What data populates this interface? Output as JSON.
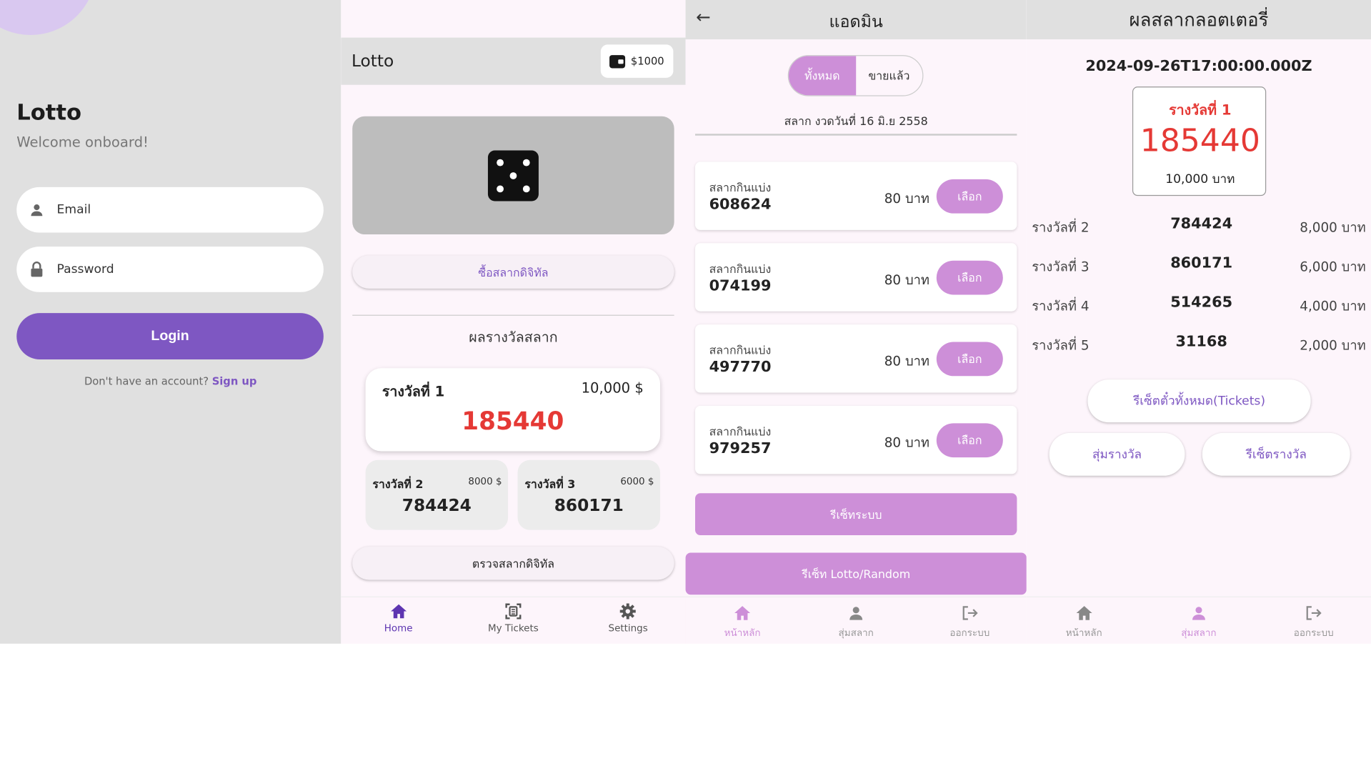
{
  "login": {
    "title": "Lotto",
    "subtitle": "Welcome onboard!",
    "email_placeholder": "Email",
    "password_placeholder": "Password",
    "login_label": "Login",
    "signup_prompt": "Don't have an account?",
    "signup_link": "Sign up",
    "accent": "#7e57c2"
  },
  "home": {
    "app_title": "Lotto",
    "wallet_balance": "$1000",
    "buy_button": "ซื้อสลากดิจิทัล",
    "results_title": "ผลรางวัลสลาก",
    "prize1": {
      "label": "รางวัลที่ 1",
      "amount": "10,000 $",
      "number": "185440"
    },
    "prize2": {
      "label": "รางวัลที่ 2",
      "amount": "8000 $",
      "number": "784424"
    },
    "prize3": {
      "label": "รางวัลที่ 3",
      "amount": "6000 $",
      "number": "860171"
    },
    "check_button": "ตรวจสลากดิจิทัล",
    "nav": [
      {
        "label": "Home",
        "icon": "home-icon",
        "active": true
      },
      {
        "label": "My Tickets",
        "icon": "ticket-icon",
        "active": false
      },
      {
        "label": "Settings",
        "icon": "gear-icon",
        "active": false
      }
    ]
  },
  "admin": {
    "title": "แอดมิน",
    "segments": [
      "ทั้งหมด",
      "ขายแล้ว"
    ],
    "date_label": "สลาก งวดวันที่ 16 มิ.ย 2558",
    "tickets": [
      {
        "kind": "สลากกินแบ่ง",
        "number": "608624",
        "price": "80 บาท",
        "select": "เลือก"
      },
      {
        "kind": "สลากกินแบ่ง",
        "number": "074199",
        "price": "80 บาท",
        "select": "เลือก"
      },
      {
        "kind": "สลากกินแบ่ง",
        "number": "497770",
        "price": "80 บาท",
        "select": "เลือก"
      },
      {
        "kind": "สลากกินแบ่ง",
        "number": "979257",
        "price": "80 บาท",
        "select": "เลือก"
      }
    ],
    "reset_system": "รีเซ็ทระบบ",
    "reset_lotto": "รีเซ็ท Lotto/Random",
    "nav": [
      {
        "label": "หน้าหลัก",
        "icon": "home-icon",
        "active": true
      },
      {
        "label": "สุ่มสลาก",
        "icon": "person-icon",
        "active": false
      },
      {
        "label": "ออกระบบ",
        "icon": "logout-icon",
        "active": false
      }
    ],
    "accent": "#cd8fd8"
  },
  "results": {
    "title": "ผลสลากลอตเตอรี่",
    "timestamp": "2024-09-26T17:00:00.000Z",
    "prize1": {
      "label": "รางวัลที่ 1",
      "number": "185440",
      "amount": "10,000 บาท"
    },
    "prizes": [
      {
        "label": "รางวัลที่ 2",
        "number": "784424",
        "amount": "8,000 บาท"
      },
      {
        "label": "รางวัลที่ 3",
        "number": "860171",
        "amount": "6,000 บาท"
      },
      {
        "label": "รางวัลที่ 4",
        "number": "514265",
        "amount": "4,000 บาท"
      },
      {
        "label": "รางวัลที่ 5",
        "number": "31168",
        "amount": "2,000 บาท"
      }
    ],
    "reset_tickets": "รีเซ็ตตั๋วทั้งหมด(Tickets)",
    "random_prize": "สุ่มรางวัล",
    "reset_prize": "รีเซ็ตรางวัล",
    "nav": [
      {
        "label": "หน้าหลัก",
        "icon": "home-icon",
        "active": false
      },
      {
        "label": "สุ่มสลาก",
        "icon": "person-icon",
        "active": true
      },
      {
        "label": "ออกระบบ",
        "icon": "logout-icon",
        "active": false
      }
    ]
  }
}
